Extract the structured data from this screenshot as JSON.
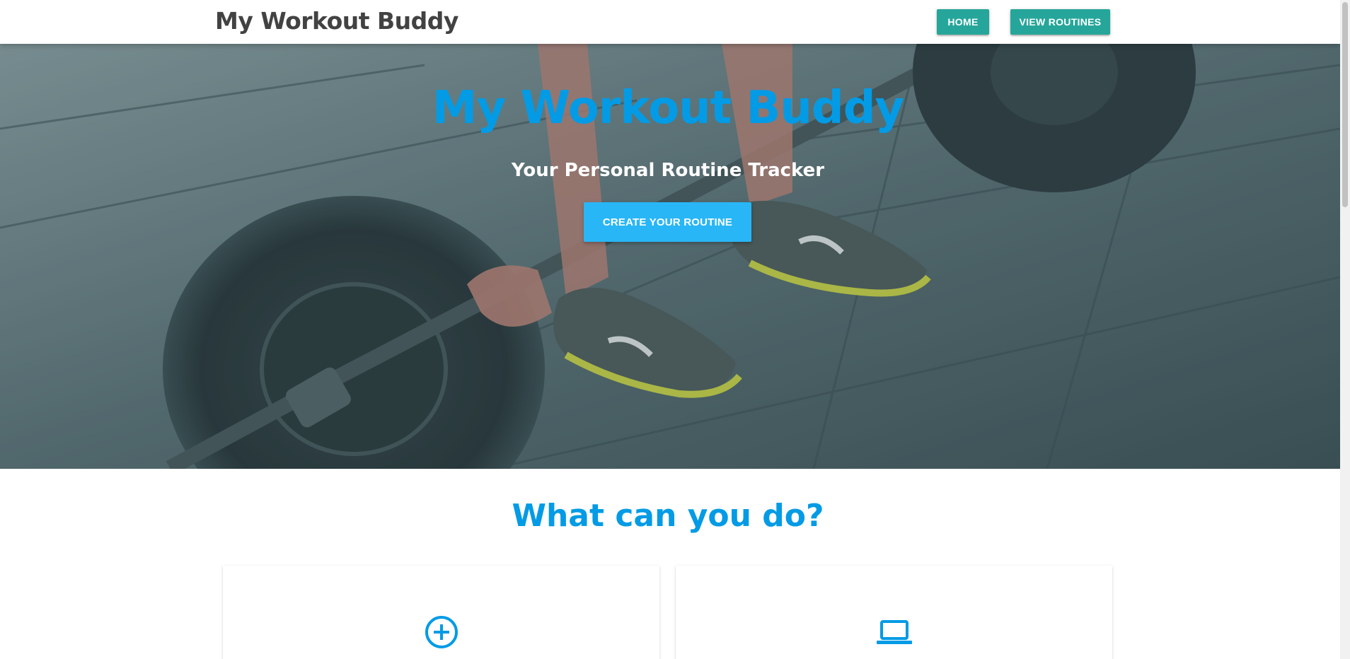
{
  "navbar": {
    "brand": "My Workout Buddy",
    "home_label": "HOME",
    "routines_label": "VIEW ROUTINES",
    "button_color": "#26a69a"
  },
  "hero": {
    "title": "My Workout Buddy",
    "subtitle": "Your Personal Routine Tracker",
    "cta_label": "CREATE YOUR ROUTINE",
    "title_color": "#039be5",
    "cta_color": "#29b6f6"
  },
  "features": {
    "heading": "What can you do?",
    "cards": [
      {
        "icon": "add-circle-icon"
      },
      {
        "icon": "laptop-icon"
      }
    ]
  }
}
